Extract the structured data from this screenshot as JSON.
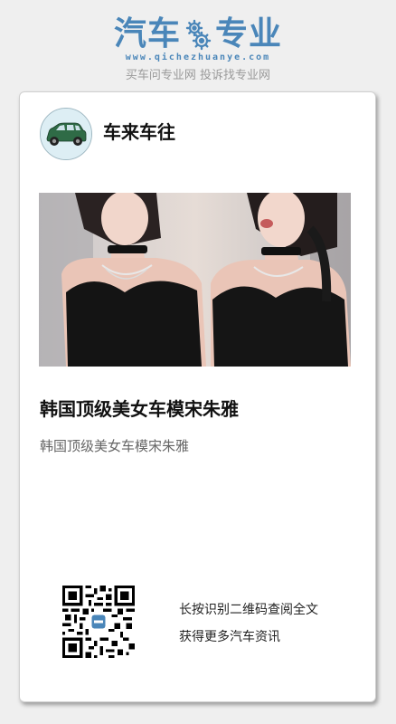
{
  "logo": {
    "left_text": "汽车",
    "right_text": "专业",
    "gear_icon": "gear-icon",
    "url": "www.qichezhuanye.com",
    "tagline": "买车问专业网 投诉找专业网",
    "brand_color": "#4a86b9"
  },
  "card": {
    "author": {
      "avatar_icon": "car-icon",
      "name": "车来车往"
    },
    "image": {
      "icon": "photo-two-women-in-black-tops"
    },
    "title": "韩国顶级美女车模宋朱雅",
    "summary": "韩国顶级美女车模宋朱雅",
    "qr": {
      "icon": "qr-code-icon",
      "line1": "长按识别二维码查阅全文",
      "line2": "获得更多汽车资讯"
    }
  }
}
